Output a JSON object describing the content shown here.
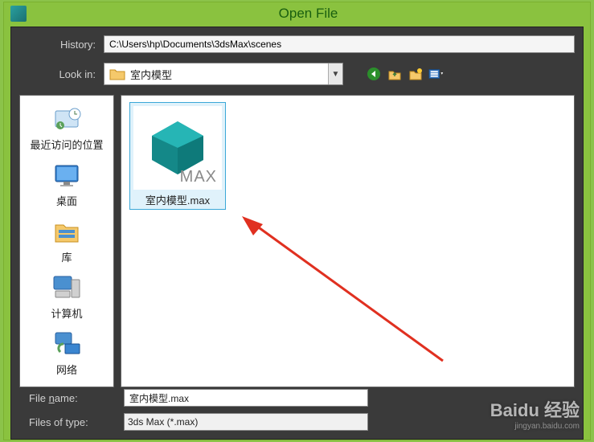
{
  "window": {
    "title": "Open File"
  },
  "history": {
    "label": "History:",
    "value": "C:\\Users\\hp\\Documents\\3dsMax\\scenes"
  },
  "lookin": {
    "label": "Look in:",
    "folder_name": "室内模型"
  },
  "sidebar": {
    "items": [
      {
        "label": "最近访问的位置"
      },
      {
        "label": "桌面"
      },
      {
        "label": "库"
      },
      {
        "label": "计算机"
      },
      {
        "label": "网络"
      }
    ]
  },
  "files": {
    "selected": {
      "name": "室内模型.max",
      "thumb_badge": "MAX"
    }
  },
  "filename": {
    "label_prefix": "File ",
    "label_u": "n",
    "label_suffix": "ame:",
    "value": "室内模型.max"
  },
  "filetype": {
    "label": "Files of type:",
    "value": "3ds Max (*.max)"
  },
  "watermark": {
    "brand": "Baidu 经验",
    "sub": "jingyan.baidu.com"
  }
}
